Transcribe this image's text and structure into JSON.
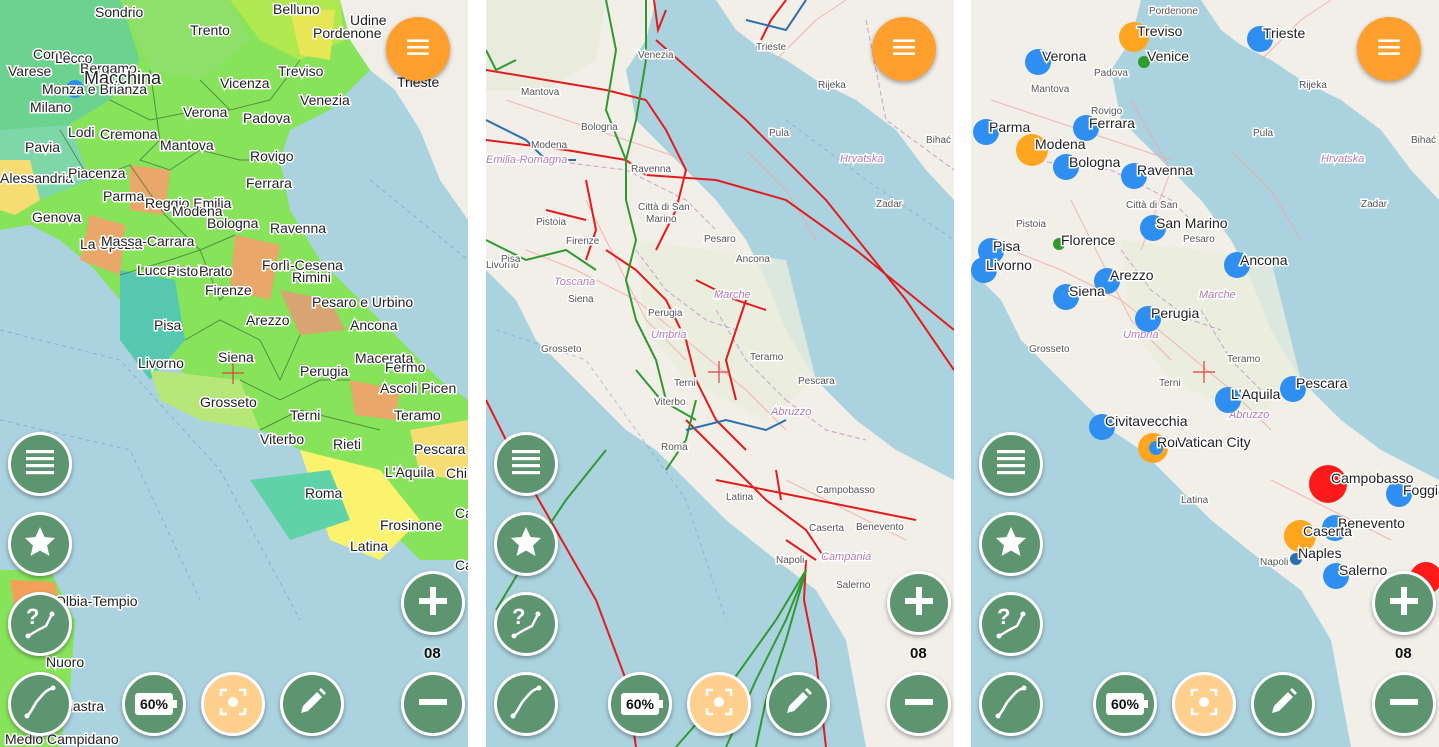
{
  "colors": {
    "sea": "#aad3df",
    "fab_orange": "#ff9f2e",
    "btn_green": "#5d9571",
    "locate_light": "#ffcf8e",
    "poi_blue": "#2f8ff0",
    "poi_orange": "#ffa51f",
    "poi_red": "#ff1a1a",
    "rail_red": "#e21c1c",
    "rail_green": "#2f9a2f",
    "rail_blue": "#2a6fb0"
  },
  "controls": {
    "menu_fab_icon": "hamburger-icon",
    "layers_icon": "layers-icon",
    "favorites_icon": "star-icon",
    "help_route_icon": "question-route-icon",
    "track_icon": "curve-track-icon",
    "battery_label": "60%",
    "locate_icon": "crosshair-icon",
    "edit_icon": "pencil-icon",
    "zoom_in_icon": "plus-icon",
    "zoom_out_icon": "minus-icon",
    "zoom_level": "08"
  },
  "panel1": {
    "labels": [
      "Sondrio",
      "Belluno",
      "Udine",
      "Trento",
      "Pordenone",
      "Como",
      "Lecco",
      "Bergamo",
      "Varese",
      "Macchina",
      "Monza e Brianza",
      "Vicenza",
      "Treviso",
      "Milano",
      "Verona",
      "Venezia",
      "Padova",
      "Lodi",
      "Cremona",
      "Pavia",
      "Mantova",
      "Rovigo",
      "Alessandria",
      "Piacenza",
      "Ferrara",
      "Parma",
      "Reggio Emilia",
      "Modena",
      "Genova",
      "Bologna",
      "La Spezia",
      "Massa-Carrara",
      "Ravenna",
      "Forlì-Cesena",
      "Rimini",
      "Lucca",
      "Pistoia",
      "Prato",
      "Firenze",
      "Pesaro e Urbino",
      "Pisa",
      "Arezzo",
      "Ancona",
      "Livorno",
      "Siena",
      "Macerata",
      "Fermo",
      "Perugia",
      "Ascoli Piceno",
      "Grosseto",
      "Teramo",
      "Terni",
      "Pescara",
      "Viterbo",
      "Rieti",
      "L'Aquila",
      "Chieti",
      "Roma",
      "Frosinone",
      "Caserta",
      "Latina",
      "Olbia-Tempio",
      "Nuoro",
      "Ogliastra",
      "Medio Campidano",
      "Trieste"
    ]
  },
  "panel2": {
    "labels": [
      "Venezia",
      "Trieste",
      "Rijeka",
      "Pula",
      "Hrvatska",
      "Bihać",
      "Zadar",
      "Mantova",
      "Modena",
      "Emilia-Romagna",
      "Bologna",
      "Ravenna",
      "Città di San Marino",
      "Pesaro",
      "Pistoia",
      "Firenze",
      "Livorno",
      "Pisa",
      "Siena",
      "Toscana",
      "Grosseto",
      "Perugia",
      "Umbria",
      "Ancona",
      "Marche",
      "Terni",
      "Teramo",
      "Pescara",
      "Abruzzo",
      "Viterbo",
      "Roma",
      "Latina",
      "Campobasso",
      "Benevento",
      "Caserta",
      "Napoli",
      "Salerno",
      "Campania"
    ]
  },
  "panel3": {
    "poi_labels": [
      "Treviso",
      "Trieste",
      "Verona",
      "Venice",
      "Parma",
      "Ferrara",
      "Modena",
      "Bologna",
      "Ravenna",
      "San Marino",
      "Pisa",
      "Florence",
      "Livorno",
      "Arezzo",
      "Ancona",
      "Siena",
      "Perugia",
      "Pescara",
      "L'Aquila",
      "Civitavecchia",
      "Rome",
      "Vatican City",
      "Campobasso",
      "Foggia",
      "Benevento",
      "Caserta",
      "Naples",
      "Salerno"
    ],
    "base_labels": [
      "Pordenone",
      "Hrvatska",
      "Rijeka",
      "Pula",
      "Bihać",
      "Zadar",
      "Padova",
      "Rovigo",
      "Mantova",
      "Pistoia",
      "Città di San Marino",
      "Pesaro",
      "Marche",
      "Umbria",
      "Terni",
      "Teramo",
      "Abruzzo",
      "Grosseto",
      "Latina",
      "Napoli"
    ]
  }
}
